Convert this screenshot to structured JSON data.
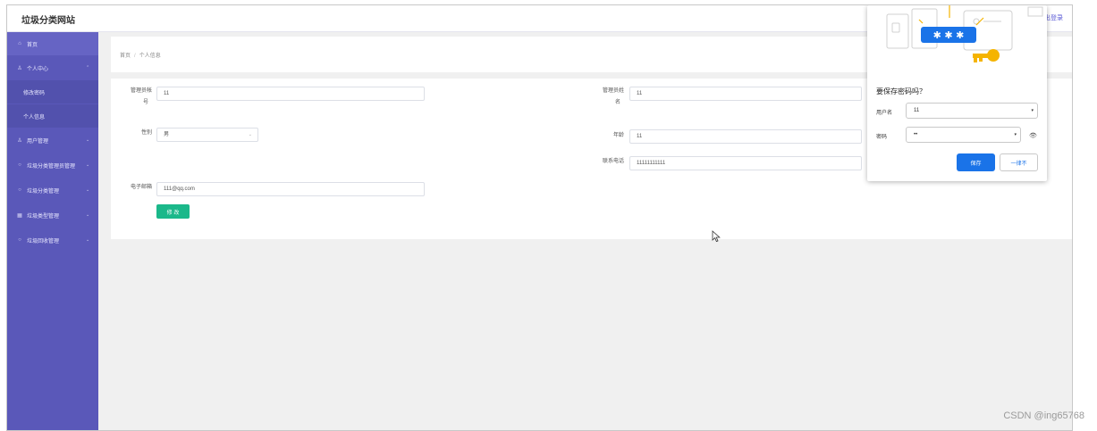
{
  "header": {
    "site_title": "垃圾分类网站",
    "logout": "出登录"
  },
  "sidebar": {
    "items": [
      {
        "label": "首页",
        "icon": "home-icon",
        "glyph": "⌂"
      },
      {
        "label": "个人中心",
        "icon": "user-icon",
        "glyph": "♙",
        "chevron": "⌃"
      },
      {
        "label": "修改密码"
      },
      {
        "label": "个人信息"
      },
      {
        "label": "用户管理",
        "icon": "user-icon",
        "glyph": "♙",
        "chevron": "⌄"
      },
      {
        "label": "垃圾分类管理员管理",
        "icon": "circle-icon",
        "glyph": "○",
        "chevron": "⌄"
      },
      {
        "label": "垃圾分类管理",
        "icon": "circle-icon",
        "glyph": "○",
        "chevron": "⌄"
      },
      {
        "label": "垃圾类型管理",
        "icon": "grid-icon",
        "glyph": "▦",
        "chevron": "⌄"
      },
      {
        "label": "垃圾回收管理",
        "icon": "circle-icon",
        "glyph": "○",
        "chevron": "⌄"
      }
    ]
  },
  "breadcrumb": {
    "home": "首页",
    "sep": "/",
    "current": "个人信息"
  },
  "form": {
    "account_label_1": "管理员帐",
    "account_label_2": "号",
    "account_value": "11",
    "gender_label": "性别",
    "gender_value": "男",
    "name_label_1": "管理员姓",
    "name_label_2": "名",
    "name_value": "11",
    "age_label": "年龄",
    "age_value": "11",
    "phone_label": "联系电话",
    "phone_value": "11111111111",
    "email_label": "电子邮箱",
    "email_value": "111@qq.com",
    "submit_label": "修 改",
    "select_arrow": "⌄"
  },
  "password_popup": {
    "title": "要保存密码吗？",
    "username_label": "用户名",
    "username_value": "11",
    "password_label": "密码",
    "password_value": "••",
    "dropdown_glyph": "▾",
    "eye_glyph": "👁",
    "save_label": "保存",
    "never_label": "一律不",
    "art_stars": "✱ ✱ ✱",
    "accent_color": "#1a73e8"
  },
  "watermark": "CSDN @ing65768"
}
